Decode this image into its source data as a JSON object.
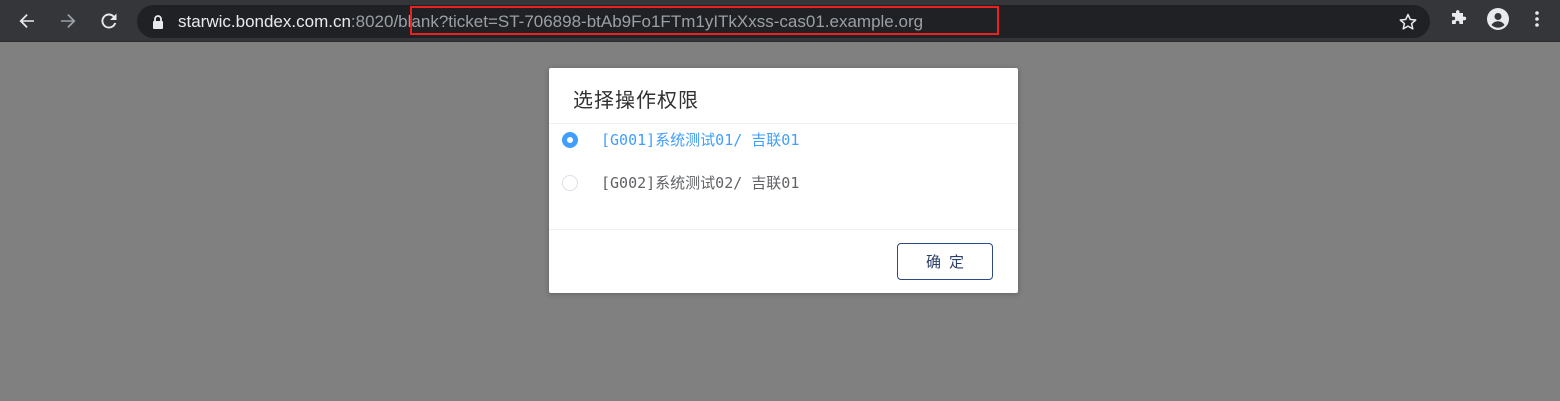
{
  "browser": {
    "url_host": "starwic.bondex.com.cn",
    "url_port": ":8020",
    "url_path": "/blank?ticket=ST-706898-btAb9Fo1FTm1yITkXxss-cas01.example.org",
    "icons": {
      "back": "arrow-left-icon",
      "forward": "arrow-right-icon",
      "reload": "reload-icon",
      "lock": "lock-icon",
      "bookmark": "star-icon",
      "extensions": "puzzle-icon",
      "profile": "profile-icon",
      "menu": "kebab-menu-icon"
    },
    "highlight_color": "#e8231f"
  },
  "dialog": {
    "title": "选择操作权限",
    "options": [
      {
        "label": "[G001]系统测试01/ 吉联01",
        "selected": true
      },
      {
        "label": "[G002]系统测试02/ 吉联01",
        "selected": false
      }
    ],
    "confirm_label": "确定",
    "accent_color": "#409eff"
  }
}
